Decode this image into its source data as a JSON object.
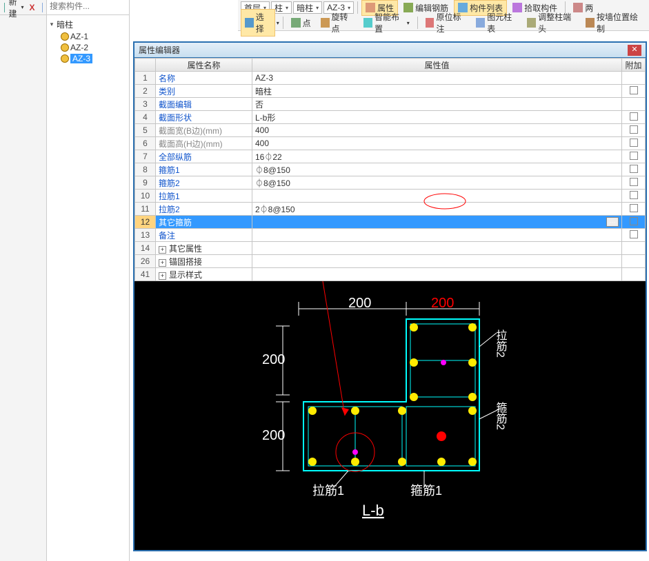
{
  "toolbar_top_left": {
    "new_label": "新建",
    "x": "X"
  },
  "tree_search_placeholder": "搜索构件...",
  "tree": {
    "root": "暗柱",
    "items": [
      "AZ-1",
      "AZ-2",
      "AZ-3"
    ],
    "selected": "AZ-3"
  },
  "topbar": {
    "row1": {
      "combo1": "首层",
      "combo2": "柱",
      "combo3": "暗柱",
      "combo4": "AZ-3",
      "btn_prop": "属性",
      "btn_editbar": "编辑钢筋",
      "btn_list": "构件列表",
      "btn_pick": "拾取构件",
      "btn_two": "两"
    },
    "row2": {
      "btn_select": "选择",
      "btn_point": "点",
      "btn_rotpt": "旋转点",
      "btn_smart": "智能布置",
      "btn_origmark": "原位标注",
      "btn_coltbl": "图元柱表",
      "btn_adjhead": "调整柱端头",
      "btn_wallpos": "按墙位置绘制"
    }
  },
  "dialog": {
    "title": "属性编辑器",
    "headers": {
      "name": "属性名称",
      "value": "属性值",
      "extra": "附加"
    },
    "rows": [
      {
        "n": "1",
        "k": "名称",
        "v": "AZ-3",
        "link": true,
        "chk": false
      },
      {
        "n": "2",
        "k": "类别",
        "v": "暗柱",
        "link": true,
        "chk": true
      },
      {
        "n": "3",
        "k": "截面编辑",
        "v": "否",
        "link": true,
        "chk": false
      },
      {
        "n": "4",
        "k": "截面形状",
        "v": "L-b形",
        "link": true,
        "chk": true
      },
      {
        "n": "5",
        "k": "截面宽(B边)(mm)",
        "v": "400",
        "link": false,
        "chk": true
      },
      {
        "n": "6",
        "k": "截面高(H边)(mm)",
        "v": "400",
        "link": false,
        "chk": true
      },
      {
        "n": "7",
        "k": "全部纵筋",
        "v": "16⏀22",
        "link": true,
        "chk": true
      },
      {
        "n": "8",
        "k": "箍筋1",
        "v": "⏀8@150",
        "link": true,
        "chk": true
      },
      {
        "n": "9",
        "k": "箍筋2",
        "v": "⏀8@150",
        "link": true,
        "chk": true
      },
      {
        "n": "10",
        "k": "拉筋1",
        "v": "",
        "link": true,
        "chk": true
      },
      {
        "n": "11",
        "k": "拉筋2",
        "v": "2⏀8@150",
        "link": true,
        "chk": true
      },
      {
        "n": "12",
        "k": "其它箍筋",
        "v": "",
        "link": false,
        "sel": true,
        "btn": true,
        "chk": true
      },
      {
        "n": "13",
        "k": "备注",
        "v": "",
        "link": true,
        "chk": true
      },
      {
        "n": "14",
        "k": "其它属性",
        "v": "",
        "link": false,
        "exp": true,
        "chk": false
      },
      {
        "n": "26",
        "k": "锚固搭接",
        "v": "",
        "link": false,
        "exp": true,
        "chk": false
      },
      {
        "n": "41",
        "k": "显示样式",
        "v": "",
        "link": false,
        "exp": true,
        "chk": false
      }
    ]
  },
  "diagram": {
    "dim200": "200",
    "dim200r": "200",
    "label_la1": "拉筋1",
    "label_gu1": "箍筋1",
    "label_la2": "拉筋2",
    "label_gu2": "箍筋2",
    "title": "L-b"
  }
}
